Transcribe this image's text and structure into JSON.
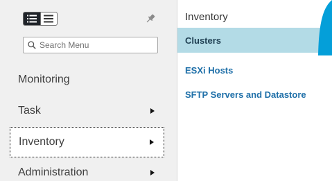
{
  "nav": {
    "search": {
      "placeholder": "Search Menu",
      "value": ""
    },
    "items": [
      {
        "label": "Monitoring",
        "has_submenu": false
      },
      {
        "label": "Task",
        "has_submenu": true
      },
      {
        "label": "Inventory",
        "has_submenu": true,
        "selected": true
      },
      {
        "label": "Administration",
        "has_submenu": true
      }
    ]
  },
  "submenu": {
    "title": "Inventory",
    "items": [
      {
        "label": "Clusters",
        "highlighted": true
      },
      {
        "label": "ESXi Hosts"
      },
      {
        "label": "SFTP Servers and Datastore"
      }
    ]
  },
  "colors": {
    "highlight": "#b3dbe6",
    "link": "#1e6fa8",
    "accent": "#049fd9",
    "panel": "#f0f0f0"
  }
}
